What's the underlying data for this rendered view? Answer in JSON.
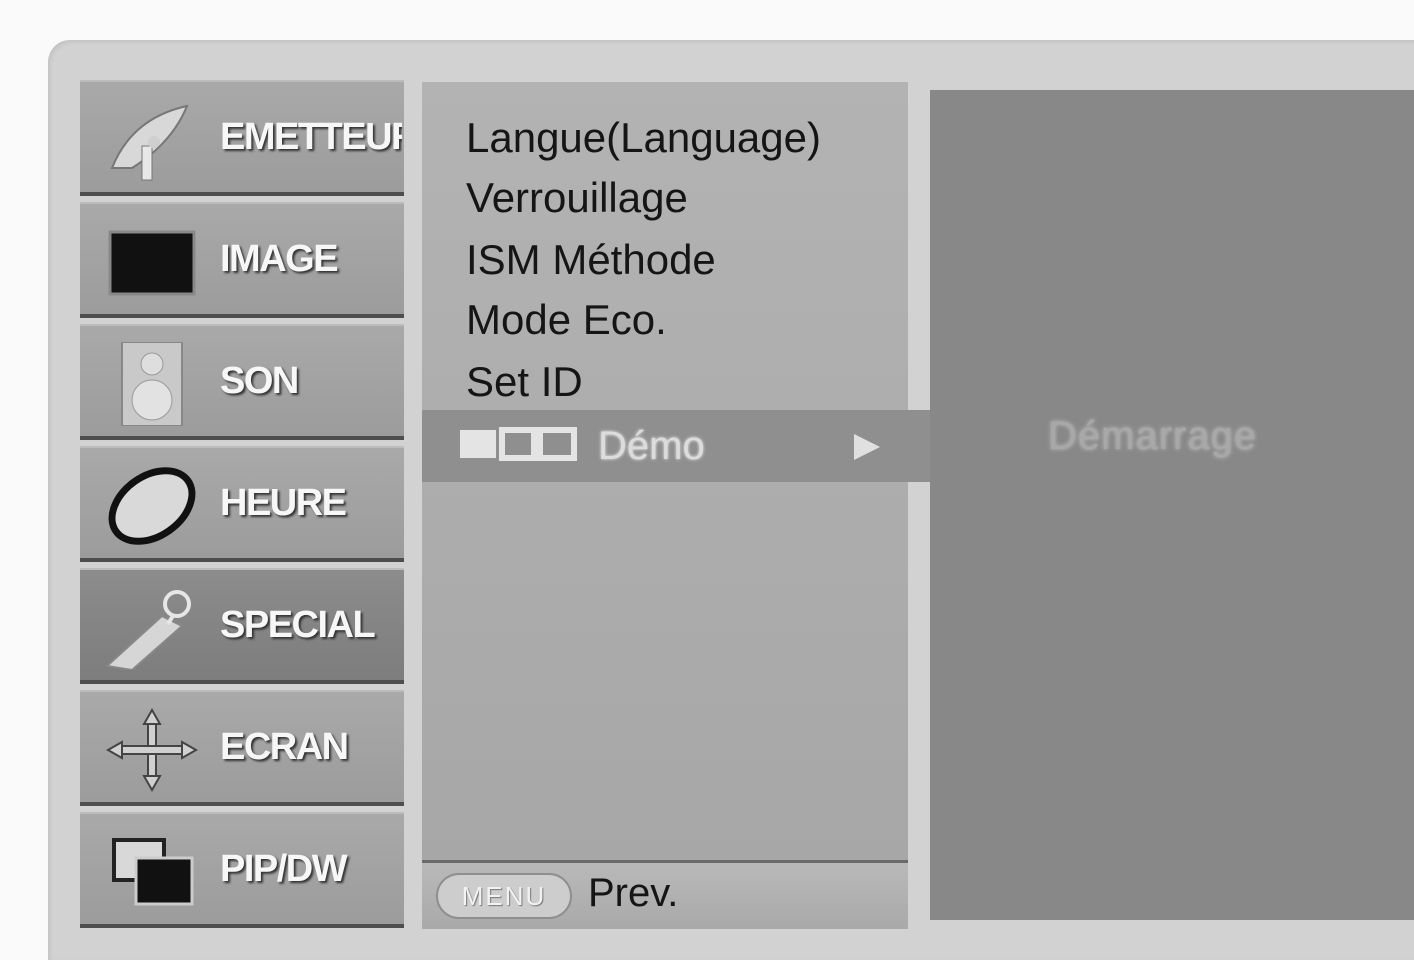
{
  "sidebar": {
    "items": [
      {
        "label": "EMETTEUR",
        "icon": "satellite-dish-icon"
      },
      {
        "label": "IMAGE",
        "icon": "picture-icon"
      },
      {
        "label": "SON",
        "icon": "speaker-icon"
      },
      {
        "label": "HEURE",
        "icon": "clock-icon"
      },
      {
        "label": "SPECIAL",
        "icon": "special-tag-icon"
      },
      {
        "label": "ECRAN",
        "icon": "move-arrows-icon"
      },
      {
        "label": "PIP/DW",
        "icon": "pip-windows-icon"
      }
    ],
    "active": "SPECIAL"
  },
  "submenu": {
    "items": [
      {
        "label": "Langue(Language)"
      },
      {
        "label": "Verrouillage"
      },
      {
        "label": "ISM Méthode"
      },
      {
        "label": "Mode Eco."
      },
      {
        "label": "Set ID"
      },
      {
        "label": "Démo"
      }
    ],
    "selected": "Démo"
  },
  "footer": {
    "menu_button": "MENU",
    "prev_label": "Prev."
  },
  "right_panel": {
    "value": "Démarrage"
  }
}
